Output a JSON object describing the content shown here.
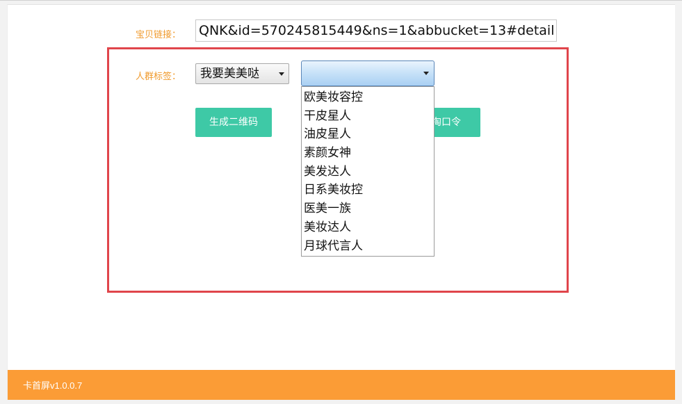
{
  "form": {
    "link_label": "宝贝链接：",
    "link_value": "QNK&id=570245815449&ns=1&abbucket=13#detail",
    "crowd_label": "人群标签：",
    "crowd_select_value": "我要美美哒",
    "sub_select_value": ""
  },
  "buttons": {
    "qrcode_label": "生成二维码",
    "taokouling_label": "淘口令"
  },
  "dropdown": {
    "options": [
      "欧美妆容控",
      "干皮星人",
      "油皮星人",
      "素颜女神",
      "美发达人",
      "日系美妆控",
      "医美一族",
      "美妆达人",
      "月球代言人"
    ]
  },
  "footer": {
    "version_text": "卡首屏v1.0.0.7"
  },
  "colors": {
    "label": "#f09a2c",
    "button": "#3ec9a6",
    "footer": "#fb9c36",
    "highlight_frame": "#e0454b"
  }
}
